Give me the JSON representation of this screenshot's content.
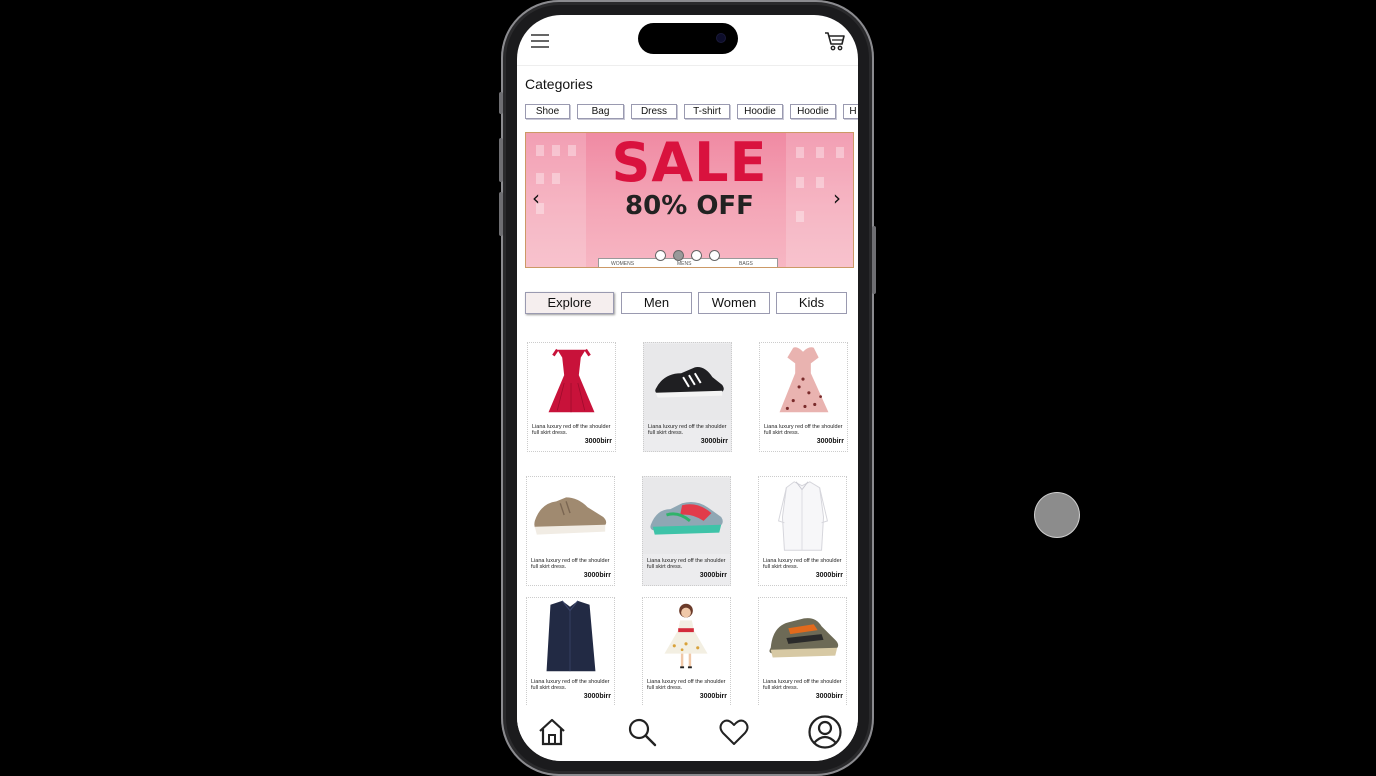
{
  "categories": {
    "title": "Categories",
    "chips": [
      "Shoe",
      "Bag",
      "Dress",
      "T-shirt",
      "Hoodie",
      "Hoodie",
      "H"
    ]
  },
  "banner": {
    "headline": "SALE",
    "subline": "80% OFF",
    "slides": 4,
    "active_slide": 1,
    "headline_color": "#d9123e",
    "strip_labels": [
      "WOMENS",
      "MENS",
      "BAGS"
    ]
  },
  "tabs": [
    "Explore",
    "Men",
    "Women",
    "Kids"
  ],
  "active_tab": "Explore",
  "products": [
    {
      "image": "red-dress-icon",
      "desc": "Liana luxury red off the shoulder full skirt dress.",
      "price": "3000birr"
    },
    {
      "image": "black-sneaker-icon",
      "desc": "Liana luxury red off the shoulder full skirt dress.",
      "price": "3000birr"
    },
    {
      "image": "floral-dress-icon",
      "desc": "Liana luxury red off the shoulder full skirt dress.",
      "price": "3000birr"
    },
    {
      "image": "suede-sneaker-icon",
      "desc": "Liana luxury red off the shoulder full skirt dress.",
      "price": "3000birr"
    },
    {
      "image": "running-shoe-icon",
      "desc": "Liana luxury red off the shoulder full skirt dress.",
      "price": "3000birr"
    },
    {
      "image": "white-shirt-icon",
      "desc": "Liana luxury red off the shoulder full skirt dress.",
      "price": "3000birr"
    },
    {
      "image": "navy-shirt-icon",
      "desc": "Liana luxury red off the shoulder full skirt dress.",
      "price": "3000birr"
    },
    {
      "image": "kids-dress-icon",
      "desc": "Liana luxury red off the shoulder full skirt dress.",
      "price": "3000birr"
    },
    {
      "image": "kids-sneaker-icon",
      "desc": "Liana luxury red off the shoulder full skirt dress.",
      "price": "3000birr"
    }
  ],
  "bottom_nav": [
    "home-icon",
    "search-icon",
    "heart-icon",
    "profile-icon"
  ]
}
